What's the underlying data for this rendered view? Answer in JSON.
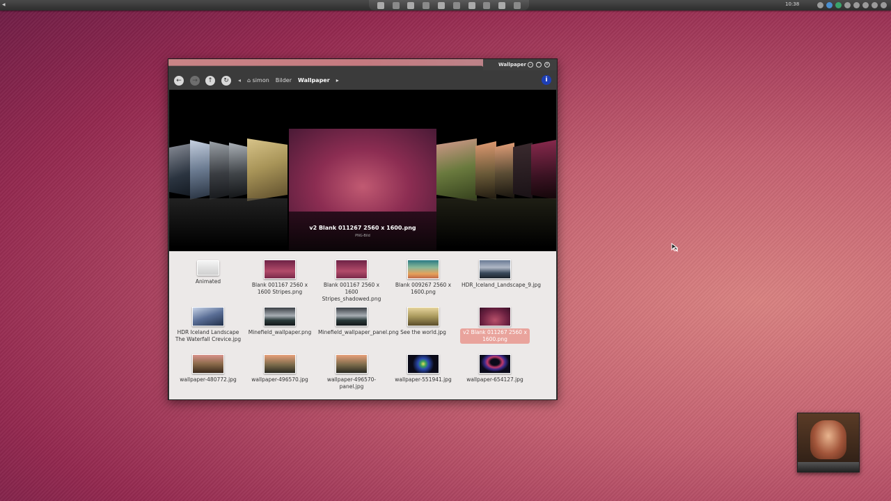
{
  "top_panel": {
    "clock": "10:38"
  },
  "window": {
    "title": "Wallpaper",
    "breadcrumbs": [
      "simon",
      "Bilder",
      "Wallpaper"
    ],
    "coverflow": {
      "current_title": "v2 Blank 011267 2560 x 1600.png",
      "current_type": "PNG-Bild"
    },
    "files": [
      {
        "name": "Animated",
        "thumb": "folder"
      },
      {
        "name": "Blank 001167 2560 x 1600 Stripes.png",
        "thumb": "magenta"
      },
      {
        "name": "Blank 001167 2560 x 1600 Stripes_shadowed.png",
        "thumb": "magenta"
      },
      {
        "name": "Blank 009267 2560 x 1600.png",
        "thumb": "teal-orange"
      },
      {
        "name": "HDR_Iceland_Landscape_9.jpg",
        "thumb": "iceland"
      },
      {
        "name": "HDR Iceland Landscape The Waterfall Crevice.jpg",
        "thumb": "ice"
      },
      {
        "name": "Minefield_wallpaper.png",
        "thumb": "mountain"
      },
      {
        "name": "Minefield_wallpaper_panel.png",
        "thumb": "mountain"
      },
      {
        "name": "See the world.jpg",
        "thumb": "field"
      },
      {
        "name": "v2 Blank 011267 2560 x 1600.png",
        "thumb": "dark-magenta",
        "selected": true
      },
      {
        "name": "wallpaper-480772.jpg",
        "thumb": "alpine"
      },
      {
        "name": "wallpaper-496570.jpg",
        "thumb": "coast"
      },
      {
        "name": "wallpaper-496570-panel.jpg",
        "thumb": "coast"
      },
      {
        "name": "wallpaper-551941.jpg",
        "thumb": "sparkle"
      },
      {
        "name": "wallpaper-654127.jpg",
        "thumb": "ring"
      }
    ]
  },
  "colors": {
    "selection": "#e9a39c",
    "info_button": "#1e3fb5",
    "grid_background": "#ece9e8"
  }
}
